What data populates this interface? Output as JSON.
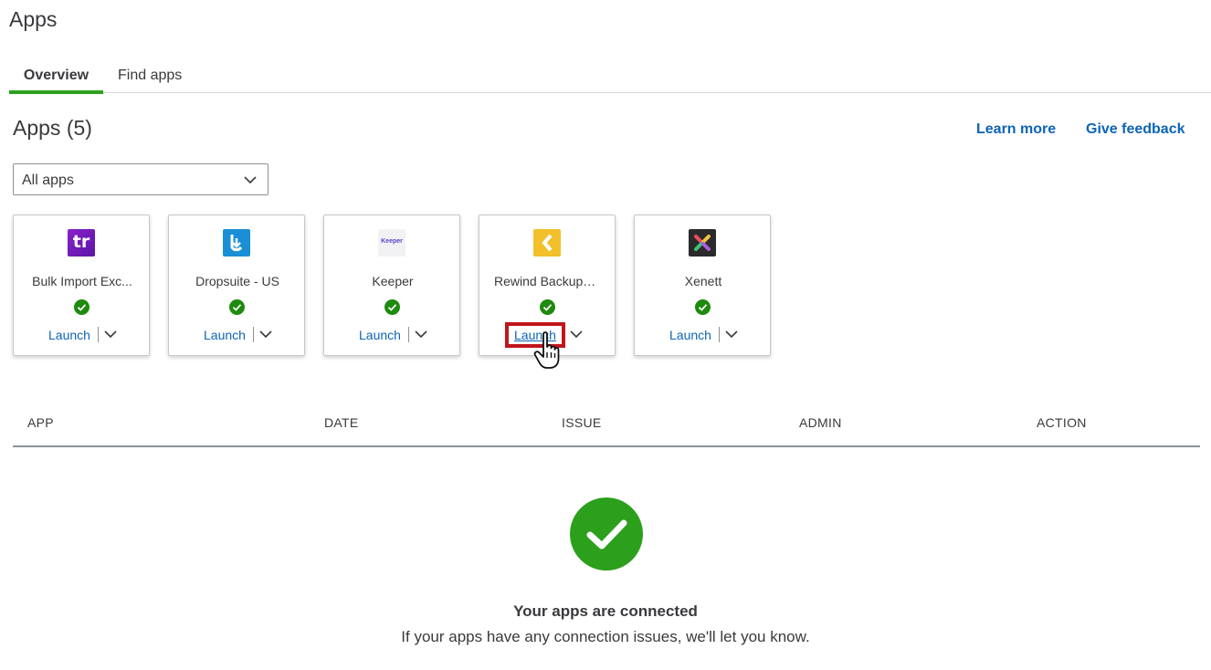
{
  "page": {
    "title": "Apps"
  },
  "tabs": [
    {
      "label": "Overview",
      "active": true
    },
    {
      "label": "Find apps",
      "active": false
    }
  ],
  "section": {
    "title": "Apps (5)"
  },
  "links": {
    "learn_more": "Learn more",
    "give_feedback": "Give feedback"
  },
  "filter": {
    "selected": "All apps"
  },
  "apps": [
    {
      "name": "Bulk Import Exc...",
      "logo": "tr",
      "launch": "Launch"
    },
    {
      "name": "Dropsuite - US",
      "logo": "dropsuite-icon",
      "launch": "Launch"
    },
    {
      "name": "Keeper",
      "logo": "Keeper",
      "launch": "Launch"
    },
    {
      "name": "Rewind Backups ...",
      "logo": "rewind-icon",
      "launch": "Launch"
    },
    {
      "name": "Xenett",
      "logo": "xenett-icon",
      "launch": "Launch"
    }
  ],
  "table": {
    "columns": [
      "APP",
      "DATE",
      "ISSUE",
      "ADMIN",
      "ACTION"
    ]
  },
  "empty_state": {
    "title": "Your apps are connected",
    "message": "If your apps have any connection issues, we'll let you know."
  },
  "colors": {
    "accent_green": "#2ca01c",
    "link_blue": "#0d65b7",
    "status_green": "#1e8a0e",
    "highlight_red": "#c0161b"
  }
}
